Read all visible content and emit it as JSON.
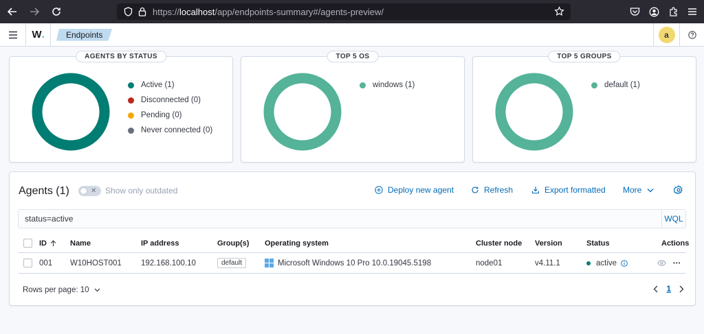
{
  "browser": {
    "url_prefix": "https://",
    "url_host": "localhost",
    "url_path": "/app/endpoints-summary#/agents-preview/"
  },
  "header": {
    "logo_text": "W",
    "logo_dot": ".",
    "breadcrumb": "Endpoints",
    "avatar_initial": "a"
  },
  "panels": [
    {
      "title": "AGENTS BY STATUS",
      "legend": [
        {
          "label": "Active (1)",
          "color": "#017d73"
        },
        {
          "label": "Disconnected (0)",
          "color": "#bd271e"
        },
        {
          "label": "Pending (0)",
          "color": "#f5a700"
        },
        {
          "label": "Never connected (0)",
          "color": "#69707d"
        }
      ],
      "ring_color": "#017d73"
    },
    {
      "title": "TOP 5 OS",
      "legend": [
        {
          "label": "windows (1)",
          "color": "#54b399"
        }
      ],
      "ring_color": "#54b399"
    },
    {
      "title": "TOP 5 GROUPS",
      "legend": [
        {
          "label": "default (1)",
          "color": "#54b399"
        }
      ],
      "ring_color": "#54b399"
    }
  ],
  "agents": {
    "title": "Agents (1)",
    "toggle_label": "Show only outdated",
    "deploy_label": "Deploy new agent",
    "refresh_label": "Refresh",
    "export_label": "Export formatted",
    "more_label": "More",
    "search_value": "status=active",
    "wql_label": "WQL",
    "columns": {
      "id": "ID",
      "name": "Name",
      "ip": "IP address",
      "groups": "Group(s)",
      "os": "Operating system",
      "node": "Cluster node",
      "version": "Version",
      "status": "Status",
      "actions": "Actions"
    },
    "rows": [
      {
        "id": "001",
        "name": "W10HOST001",
        "ip": "192.168.100.10",
        "group": "default",
        "os": "Microsoft Windows 10 Pro 10.0.19045.5198",
        "node": "node01",
        "version": "v4.11.1",
        "status": "active",
        "actions_more": "•••"
      }
    ],
    "rows_per_page": "Rows per page: 10",
    "current_page": "1"
  }
}
